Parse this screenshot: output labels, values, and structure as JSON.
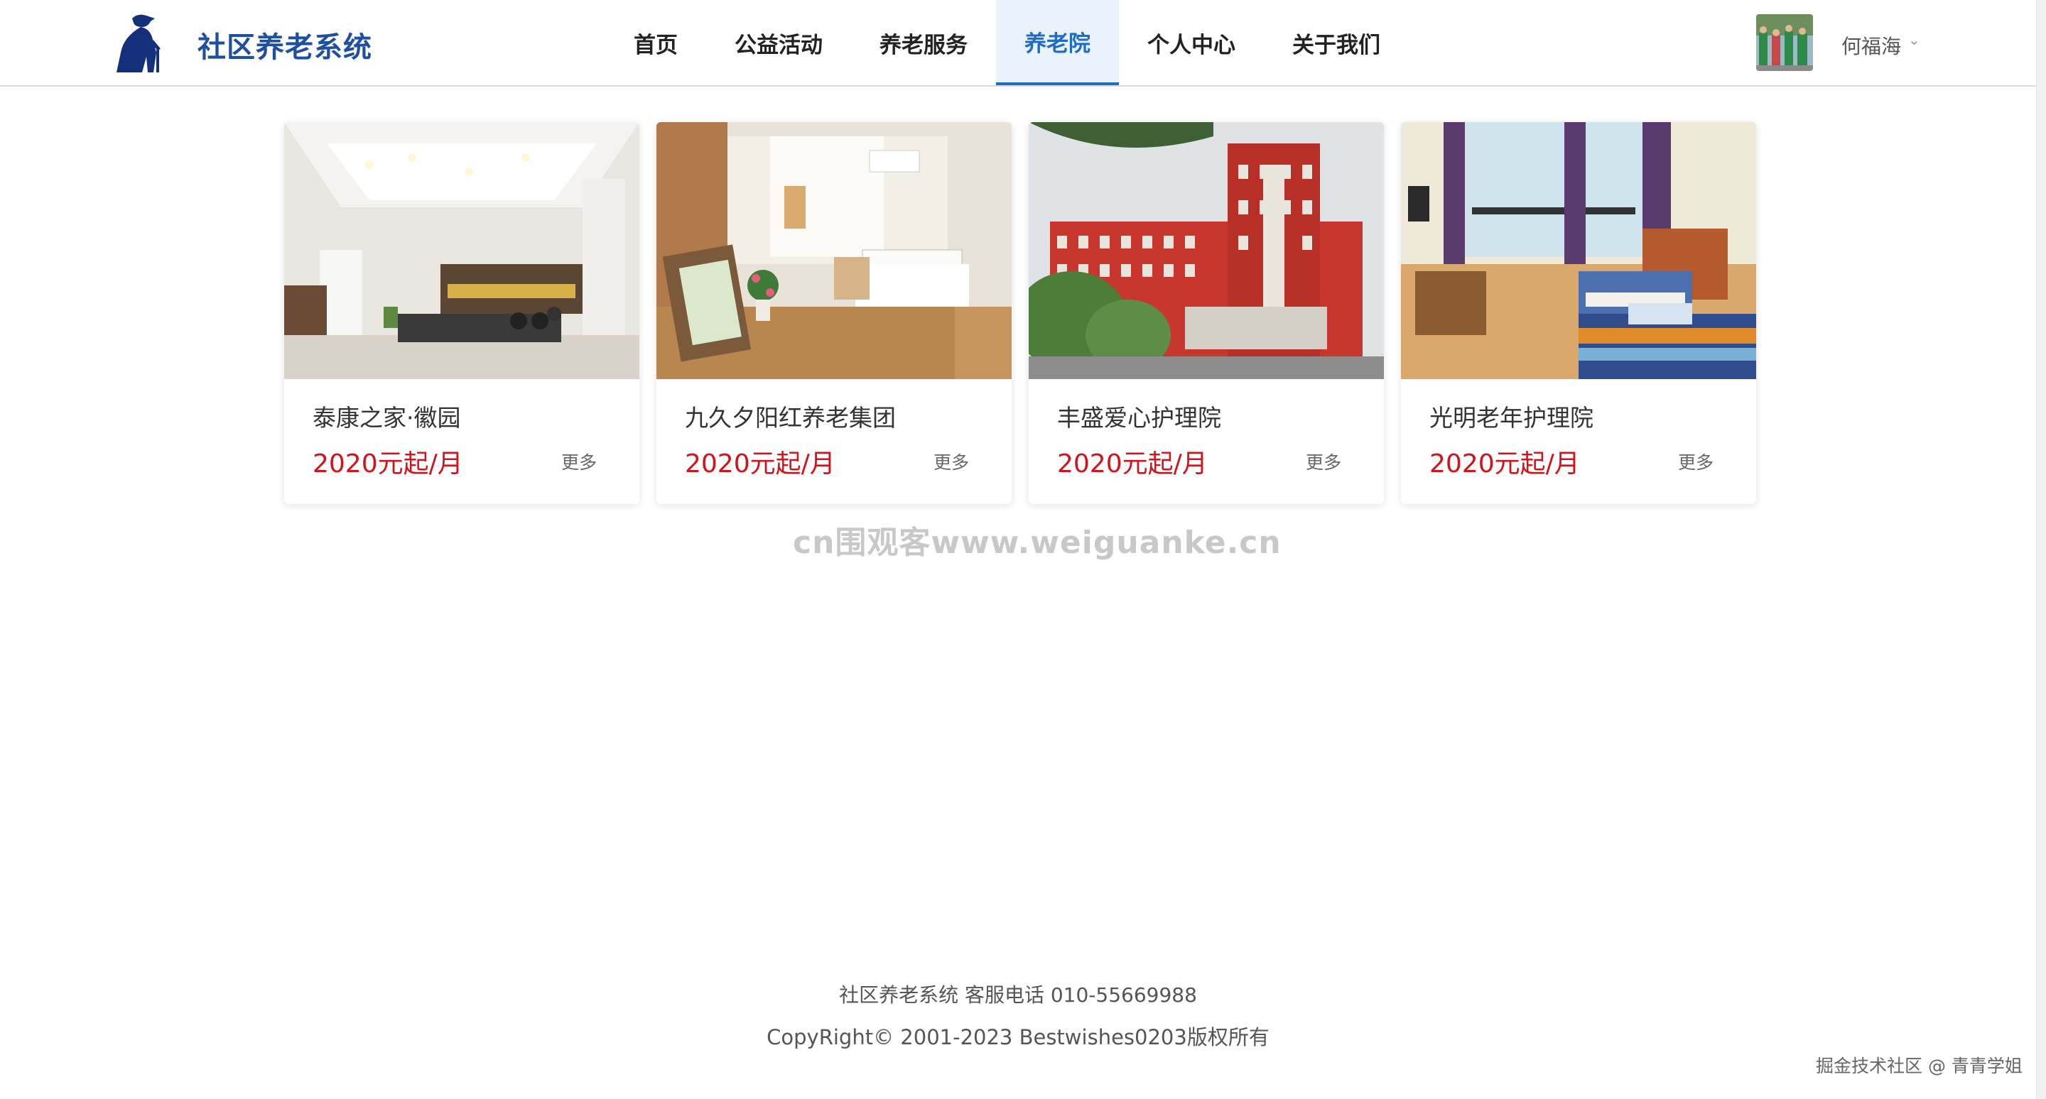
{
  "header": {
    "brand": "社区养老系统",
    "nav": [
      {
        "label": "首页",
        "active": false
      },
      {
        "label": "公益活动",
        "active": false
      },
      {
        "label": "养老服务",
        "active": false
      },
      {
        "label": "养老院",
        "active": true
      },
      {
        "label": "个人中心",
        "active": false
      },
      {
        "label": "关于我们",
        "active": false
      }
    ],
    "user": {
      "name": "何福海",
      "avatar_icon": "user-avatar"
    }
  },
  "cards": [
    {
      "name": "泰康之家·徽园",
      "price": "2020元起/月",
      "more": "更多"
    },
    {
      "name": "九久夕阳红养老集团",
      "price": "2020元起/月",
      "more": "更多"
    },
    {
      "name": "丰盛爱心护理院",
      "price": "2020元起/月",
      "more": "更多"
    },
    {
      "name": "光明老年护理院",
      "price": "2020元起/月",
      "more": "更多"
    }
  ],
  "watermark": "cn围观客www.weiguanke.cn",
  "footer": {
    "line1": "社区养老系统 客服电话 010-55669988",
    "line2": "CopyRight© 2001-2023 Bestwishes0203版权所有"
  },
  "credit": "掘金技术社区 @ 青青学姐",
  "colors": {
    "brand": "#1e4fa0",
    "accent": "#1e6bc8",
    "price": "#d1141b"
  }
}
